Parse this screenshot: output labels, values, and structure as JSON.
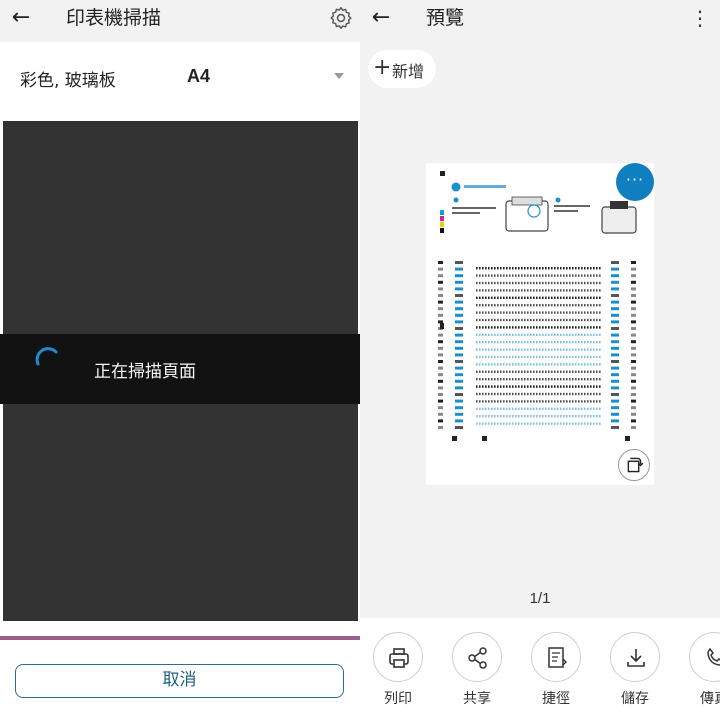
{
  "left": {
    "header": {
      "title": "印表機掃描",
      "back_icon": "arrow-left-icon",
      "settings_icon": "gear-icon"
    },
    "settings": {
      "source": "彩色, 玻璃板",
      "paper_size": "A4",
      "dropdown_icon": "dropdown-triangle-icon"
    },
    "overlay": {
      "message": "正在掃描頁面",
      "spinner_icon": "loading-spinner-icon"
    },
    "cancel_label": "取消",
    "colors": {
      "accent": "#1e5f80",
      "progress": "#9c5f8c",
      "canvas": "#333333"
    }
  },
  "right": {
    "header": {
      "title": "預覽",
      "back_icon": "arrow-left-icon",
      "more_icon": "more-vertical-icon"
    },
    "add_label": "新增",
    "fab_label": "···",
    "page_counter": "1/1",
    "actions": [
      {
        "label": "列印",
        "icon": "printer-icon"
      },
      {
        "label": "共享",
        "icon": "share-icon"
      },
      {
        "label": "捷徑",
        "icon": "shortcut-icon"
      },
      {
        "label": "儲存",
        "icon": "download-icon"
      },
      {
        "label": "傳真",
        "icon": "fax-icon"
      }
    ],
    "colors": {
      "fab": "#0f7fc0"
    }
  }
}
